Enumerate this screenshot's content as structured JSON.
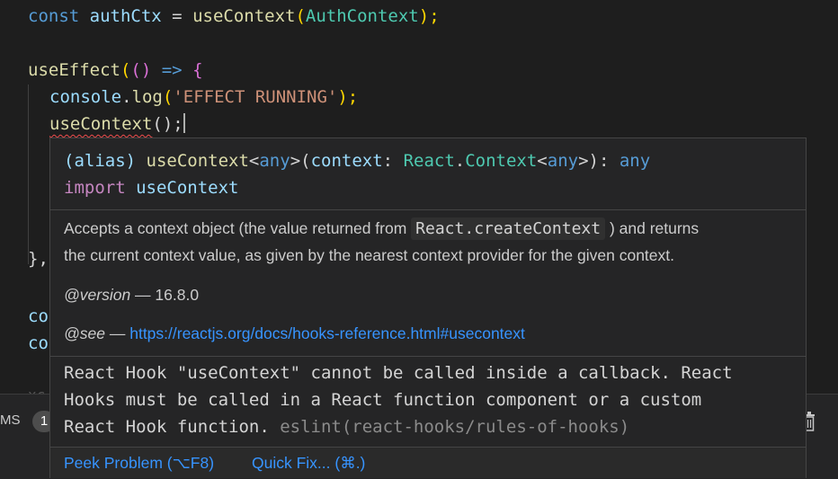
{
  "editor": {
    "line1": {
      "kw": "const",
      "var": "authCtx",
      "op": " = ",
      "fn": "useContext",
      "open": "(",
      "cls": "AuthContext",
      "close": ");"
    },
    "line3": {
      "fn": "useEffect",
      "open": "(",
      "args": "() ",
      "arrow": "=>",
      "brace": " {"
    },
    "line4": {
      "obj": "console",
      "dot": ".",
      "fn": "log",
      "open": "(",
      "str": "'EFFECT RUNNING'",
      "close": ");"
    },
    "line5": {
      "fn": "useContext",
      "rest": "();"
    },
    "line_close": "},",
    "line_co1": "co",
    "line_co2": "co",
    "line_faint": "xc"
  },
  "hover": {
    "signature": {
      "alias": "(alias) ",
      "fn": "useContext",
      "lt": "<",
      "any1": "any",
      "gt": ">",
      "open": "(",
      "param": "context",
      "colon": ": ",
      "ns": "React",
      "dot": ".",
      "type": "Context",
      "lt2": "<",
      "any2": "any",
      "gt2": ">",
      "close": "): ",
      "ret": "any"
    },
    "import_kw": "import",
    "import_name": "useContext",
    "description_pre": "Accepts a context object (the value returned from ",
    "description_code": "React.createContext",
    "description_post": " ) and returns",
    "description_line2": "the current context value, as given by the nearest context provider for the given context.",
    "version_tag": "@version",
    "version_sep": " — ",
    "version_value": "16.8.0",
    "see_tag": "@see",
    "see_sep": " — ",
    "see_link": "https://reactjs.org/docs/hooks-reference.html#usecontext",
    "error_line1": "React Hook \"useContext\" cannot be called inside a callback. React",
    "error_line2": "Hooks must be called in a React function component or a custom",
    "error_line3": "React Hook function. ",
    "error_source": "eslint(react-hooks/rules-of-hooks)",
    "actions": {
      "peek": "Peek Problem (⌥F8)",
      "quickfix": "Quick Fix... (⌘.)"
    }
  },
  "panel": {
    "tab_label": "MS",
    "badge": "1"
  },
  "colors": {
    "background": "#1e1e1e",
    "hover_bg": "#252526",
    "link": "#3794ff",
    "error_squiggle": "#f14c4c"
  }
}
